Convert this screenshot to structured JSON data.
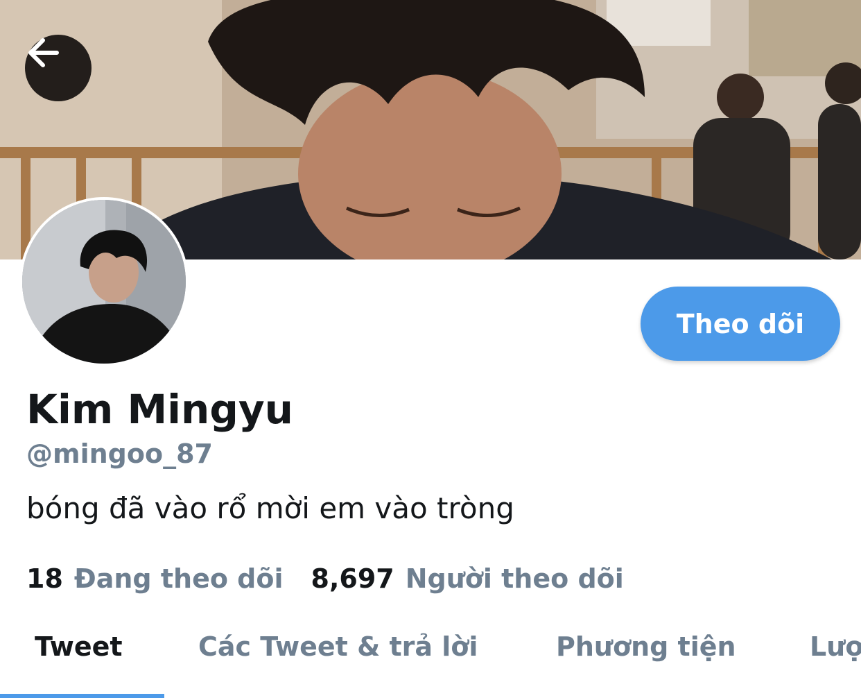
{
  "header": {
    "back_icon": "arrow-left-icon"
  },
  "profile": {
    "follow_label": "Theo dõi",
    "display_name": "Kim Mingyu",
    "handle": "@mingoo_87",
    "bio": "bóng đã vào rổ mời em vào tròng",
    "following_count": "18",
    "following_label": "Đang theo dõi",
    "followers_count": "8,697",
    "followers_label": "Người theo dõi"
  },
  "tabs": [
    {
      "label": "Tweet",
      "active": true
    },
    {
      "label": "Các Tweet & trả lời",
      "active": false
    },
    {
      "label": "Phương tiện",
      "active": false
    },
    {
      "label": "Lượt thích",
      "active": false
    }
  ],
  "colors": {
    "accent": "#4c9ae9",
    "text_primary": "#14171a",
    "text_secondary": "#6e7f90"
  }
}
